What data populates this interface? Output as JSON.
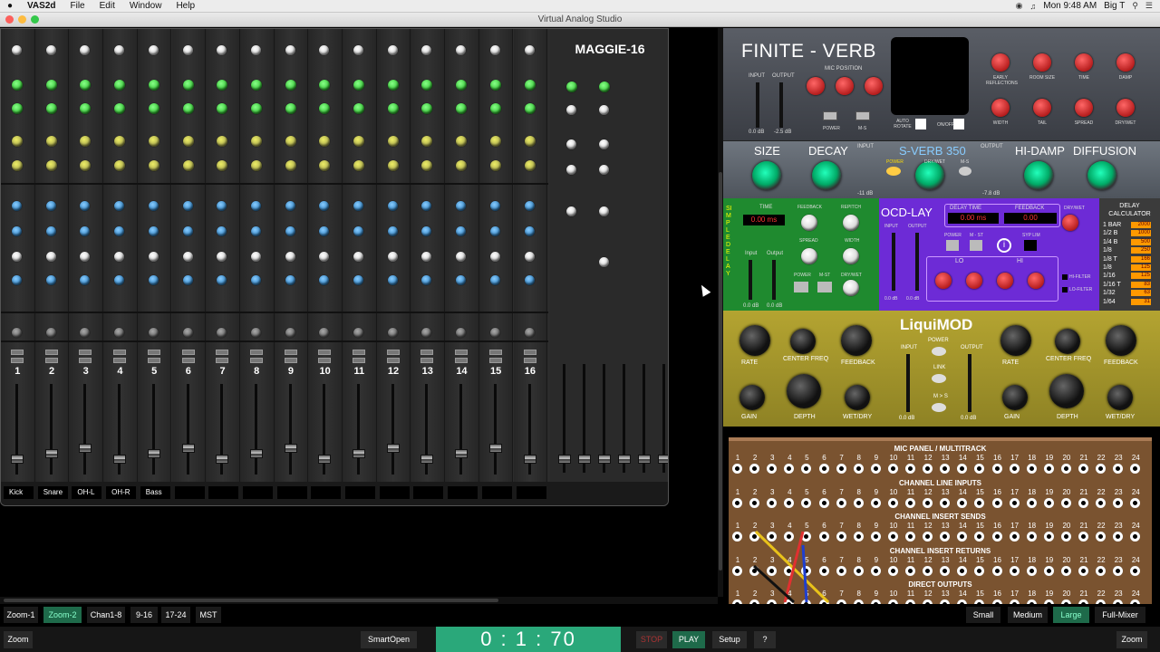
{
  "menubar": {
    "app_name": "VAS2d",
    "menus": [
      "File",
      "Edit",
      "Window",
      "Help"
    ],
    "clock": "Mon 9:48 AM",
    "user": "Big T"
  },
  "window": {
    "title": "Virtual Analog Studio"
  },
  "mixer": {
    "brand": "MAGGIE-16",
    "channels": [
      "1",
      "2",
      "3",
      "4",
      "5",
      "6",
      "7",
      "8",
      "9",
      "10",
      "11",
      "12",
      "13",
      "14",
      "15",
      "16"
    ],
    "track_names": [
      "Kick",
      "Snare",
      "OH-L",
      "OH-R",
      "Bass"
    ]
  },
  "rack": {
    "finite_verb": {
      "title": "FINITE - VERB",
      "knob_labels": [
        "EARLY REFLECTIONS",
        "ROOM SIZE",
        "TIME",
        "DAMP",
        "WIDTH",
        "TAIL",
        "SPREAD",
        "DRY/WET"
      ],
      "input_label": "INPUT",
      "output_label": "OUTPUT",
      "input_db": "0.0 dB",
      "output_db": "-2.5 dB",
      "mic_position": "MIC POSITION",
      "power": "POWER",
      "ms": "M-S",
      "auto_rotate": "AUTO ROTATE",
      "onoff": "ON/OFF"
    },
    "sverb": {
      "name": "S-VERB 350",
      "labels": [
        "SIZE",
        "DECAY",
        "HI-DAMP",
        "DIFFUSION"
      ],
      "input": "INPUT",
      "output": "OUTPUT",
      "input_db": "-11 dB",
      "output_db": "-7.8 dB",
      "power": "POWER",
      "drywet": "DRY/WET",
      "ms": "M-S"
    },
    "simple_delay": {
      "title": "SIMPLE DELAY",
      "time_label": "TIME",
      "time_value": "0.00 ms",
      "feedback": "FEEDBACK",
      "repitch": "REPITCH",
      "spread": "SPREAD",
      "width": "WIDTH",
      "input": "Input",
      "output": "Output",
      "power": "POWER",
      "mst": "M-ST",
      "drywet": "DRY/WET",
      "input_db": "0.0 dB",
      "output_db": "0.0 dB"
    },
    "ocd_lay": {
      "title": "OCD-LAY",
      "delay_time_label": "DELAY TIME",
      "delay_time": "0.00 ms",
      "feedback_label": "FEEDBACK",
      "feedback": "0.00",
      "drywet": "DRY/WET",
      "power": "POWER",
      "mst": "M - ST",
      "syp": "SYP LIM",
      "lo": "LO",
      "hi": "HI",
      "hi_filter": "HI-FILTER",
      "lo_filter": "LO-FILTER",
      "input": "INPUT",
      "output": "OUTPUT",
      "input_db": "0.0 dB",
      "output_db": "0.0 dB"
    },
    "delay_calculator": {
      "title": "DELAY CALCULATOR",
      "rows": [
        {
          "label": "1 BAR",
          "value": "2000"
        },
        {
          "label": "1/2 B",
          "value": "1000"
        },
        {
          "label": "1/4 B",
          "value": "500"
        },
        {
          "label": "1/8",
          "value": "250"
        },
        {
          "label": "1/8 T",
          "value": "166"
        },
        {
          "label": "1/8",
          "value": "125"
        },
        {
          "label": "1/16",
          "value": "125"
        },
        {
          "label": "1/16 T",
          "value": "83"
        },
        {
          "label": "1/32",
          "value": "63"
        },
        {
          "label": "1/64",
          "value": "31"
        }
      ]
    },
    "liquimod": {
      "title": "LiquiMOD",
      "labels": [
        "RATE",
        "CENTER FREQ",
        "FEEDBACK",
        "GAIN",
        "DEPTH",
        "WET/DRY"
      ],
      "power": "POWER",
      "link": "LINK",
      "ms": "M > S",
      "input": "INPUT",
      "output": "OUTPUT",
      "input_db": "0.0 dB",
      "output_db": "0.0 dB"
    },
    "patchbay": {
      "rows": [
        "MIC PANEL / MULTITRACK",
        "CHANNEL LINE INPUTS",
        "CHANNEL INSERT SENDS",
        "CHANNEL INSERT RETURNS",
        "DIRECT OUTPUTS"
      ],
      "numbers": [
        "1",
        "2",
        "3",
        "4",
        "5",
        "6",
        "7",
        "8",
        "9",
        "10",
        "11",
        "12",
        "13",
        "14",
        "15",
        "16",
        "17",
        "18",
        "19",
        "20",
        "21",
        "22",
        "23",
        "24"
      ]
    }
  },
  "viewbar": {
    "buttons": [
      "Zoom-1",
      "Zoom-2",
      "Chan1-8",
      "9-16",
      "17-24",
      "MST"
    ],
    "active": "Zoom-2",
    "sizes": [
      "Small",
      "Medium",
      "Large",
      "Full-Mixer"
    ],
    "active_size": "Large"
  },
  "transport": {
    "zoom_left": "Zoom",
    "smartopen": "SmartOpen",
    "timecode": "0 : 1 : 70",
    "stop": "STOP",
    "play": "PLAY",
    "setup": "Setup",
    "help": "?",
    "zoom_right": "Zoom"
  },
  "colors": {
    "accent": "#2aa87a",
    "mixer_bg": "#2c2c2c",
    "ocd_purple": "#6d2bd6",
    "simple_delay_green": "#1f8a2f",
    "liquimod_gold": "#b4a431",
    "patchbay_brown": "#7a5330"
  }
}
